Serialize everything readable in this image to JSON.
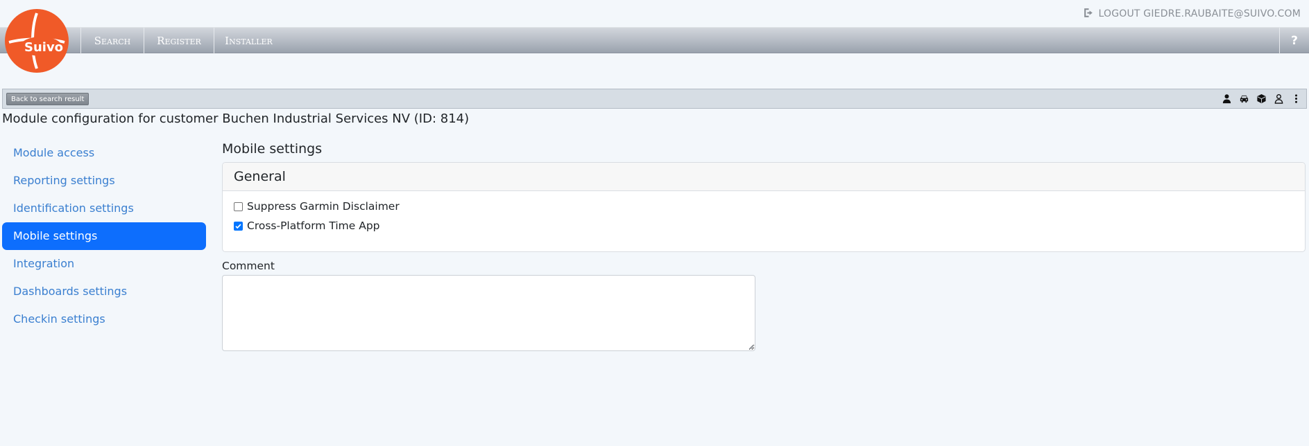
{
  "brand": {
    "logo_text": "Suivo",
    "logo_color": "#f05a28"
  },
  "header": {
    "logout_icon": "logout-icon",
    "logout_label": "LOGOUT GIEDRE.RAUBAITE@SUIVO.COM"
  },
  "nav": {
    "items": [
      {
        "label": "Search"
      },
      {
        "label": "Register"
      },
      {
        "label": "Installer"
      }
    ],
    "help_label": "?"
  },
  "toolbar": {
    "back_label": "Back to search result",
    "icons": [
      "user-solid-icon",
      "car-icon",
      "cube-icon",
      "user-outline-icon",
      "kebab-menu-icon"
    ]
  },
  "page": {
    "title": "Module configuration for customer Buchen Industrial Services NV (ID: 814)"
  },
  "sidebar": {
    "items": [
      {
        "label": "Module access",
        "active": false
      },
      {
        "label": "Reporting settings",
        "active": false
      },
      {
        "label": "Identification settings",
        "active": false
      },
      {
        "label": "Mobile settings",
        "active": true
      },
      {
        "label": "Integration",
        "active": false
      },
      {
        "label": "Dashboards settings",
        "active": false
      },
      {
        "label": "Checkin settings",
        "active": false
      }
    ],
    "active_color": "#0d6efd",
    "link_color": "#3a7fd0"
  },
  "main": {
    "section_title": "Mobile settings",
    "card": {
      "header": "General",
      "options": [
        {
          "label": "Suppress Garmin Disclaimer",
          "checked": false
        },
        {
          "label": "Cross-Platform Time App",
          "checked": true
        }
      ]
    },
    "comment": {
      "label": "Comment",
      "value": "",
      "placeholder": ""
    }
  }
}
